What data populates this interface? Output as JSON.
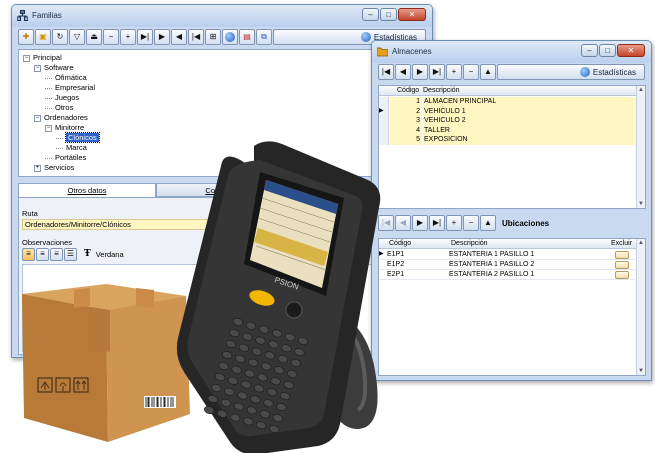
{
  "familias": {
    "title": "Familias",
    "stats_label": "Estadísticas",
    "toolbar_icons": [
      "new-icon",
      "open-icon",
      "refresh-icon",
      "filter-icon",
      "eject-icon",
      "minus-icon",
      "plus-icon",
      "last-icon",
      "next-icon",
      "prev-icon",
      "first-icon",
      "tree-icon",
      "globe-icon",
      "report-icon",
      "copy-icon"
    ],
    "tree": [
      {
        "label": "Principal",
        "level": 0,
        "expander": "−"
      },
      {
        "label": "Software",
        "level": 1,
        "expander": "−"
      },
      {
        "label": "Ofimática",
        "level": 2,
        "expander": ""
      },
      {
        "label": "Empresarial",
        "level": 2,
        "expander": ""
      },
      {
        "label": "Juegos",
        "level": 2,
        "expander": ""
      },
      {
        "label": "Otros",
        "level": 2,
        "expander": ""
      },
      {
        "label": "Ordenadores",
        "level": 1,
        "expander": "−"
      },
      {
        "label": "Minitorre",
        "level": 2,
        "expander": "−"
      },
      {
        "label": "Clónicos",
        "level": 3,
        "expander": "",
        "selected": true
      },
      {
        "label": "Marca",
        "level": 3,
        "expander": ""
      },
      {
        "label": "Portátiles",
        "level": 2,
        "expander": ""
      },
      {
        "label": "Servicios",
        "level": 1,
        "expander": "+"
      }
    ],
    "tabs": [
      "Otros datos",
      "Comisiones"
    ],
    "ruta_label": "Ruta",
    "ruta_value": "Ordenadores/Minitorre/Clónicos",
    "observaciones_label": "Observaciones",
    "font_name": "Verdana"
  },
  "almacenes": {
    "title": "Almacenes",
    "stats_label": "Estadísticas",
    "columns": [
      "Código",
      "Descripción"
    ],
    "rows": [
      {
        "codigo": "1",
        "descripcion": "ALMACEN PRINCIPAL"
      },
      {
        "codigo": "2",
        "descripcion": "VEHICULO 1"
      },
      {
        "codigo": "3",
        "descripcion": "VEHICULO 2"
      },
      {
        "codigo": "4",
        "descripcion": "TALLER"
      },
      {
        "codigo": "5",
        "descripcion": "EXPOSICION"
      }
    ],
    "ubicaciones_label": "Ubicaciones",
    "ubic_columns": [
      "Código",
      "Descripción",
      "Excluir"
    ],
    "ubic_rows": [
      {
        "codigo": "E1P1",
        "descripcion": "ESTANTERIA 1 PASILLO 1"
      },
      {
        "codigo": "E1P2",
        "descripcion": "ESTANTERIA 1 PASILLO 2"
      },
      {
        "codigo": "E2P1",
        "descripcion": "ESTANTERIA 2 PASILLO 1"
      }
    ]
  },
  "device": {
    "brand": "PSION"
  },
  "colors": {
    "window_blue": "#c9daf0",
    "selection": "#2f63c8",
    "yellow_cell": "#fff6c2"
  }
}
